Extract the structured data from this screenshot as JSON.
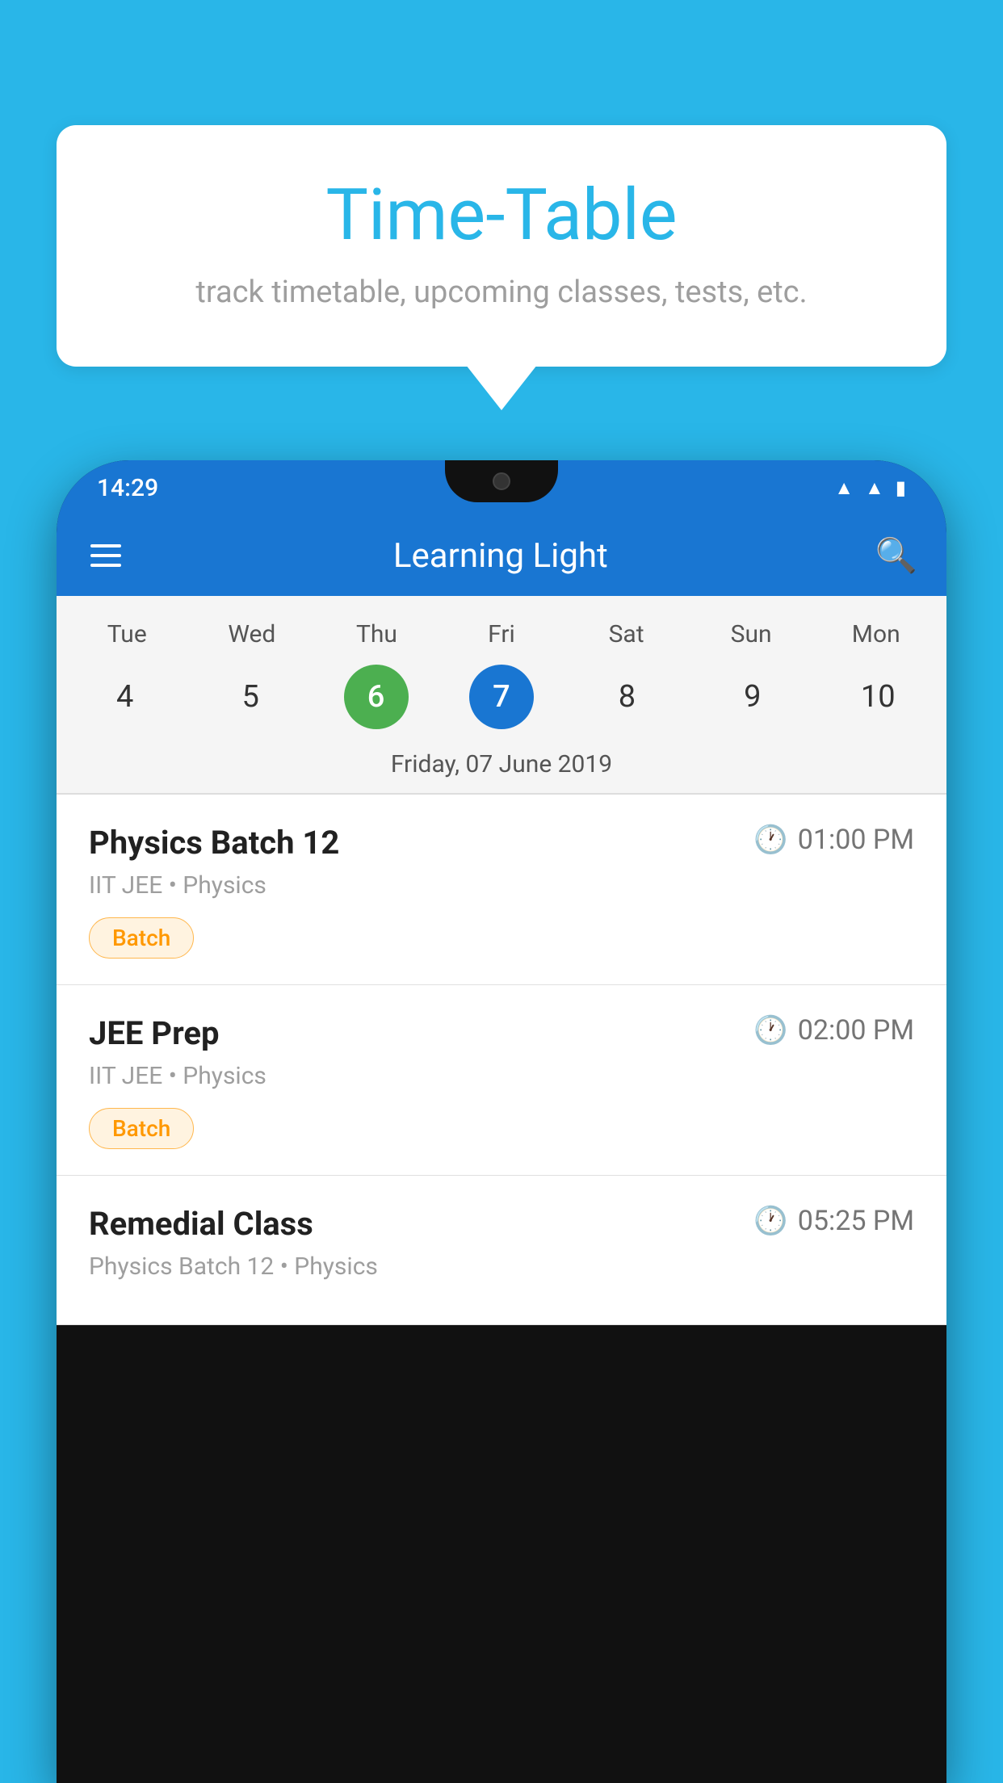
{
  "background_color": "#29B6E8",
  "bubble": {
    "title": "Time-Table",
    "subtitle": "track timetable, upcoming classes, tests, etc."
  },
  "phone": {
    "status_bar": {
      "time": "14:29"
    },
    "app_bar": {
      "title": "Learning Light"
    },
    "calendar": {
      "days": [
        {
          "label": "Tue",
          "number": "4"
        },
        {
          "label": "Wed",
          "number": "5"
        },
        {
          "label": "Thu",
          "number": "6",
          "state": "today"
        },
        {
          "label": "Fri",
          "number": "7",
          "state": "selected"
        },
        {
          "label": "Sat",
          "number": "8"
        },
        {
          "label": "Sun",
          "number": "9"
        },
        {
          "label": "Mon",
          "number": "10"
        }
      ],
      "selected_date": "Friday, 07 June 2019"
    },
    "schedule": [
      {
        "title": "Physics Batch 12",
        "time": "01:00 PM",
        "subtitle": "IIT JEE • Physics",
        "badge": "Batch"
      },
      {
        "title": "JEE Prep",
        "time": "02:00 PM",
        "subtitle": "IIT JEE • Physics",
        "badge": "Batch"
      },
      {
        "title": "Remedial Class",
        "time": "05:25 PM",
        "subtitle": "Physics Batch 12 • Physics",
        "badge": null
      }
    ]
  }
}
